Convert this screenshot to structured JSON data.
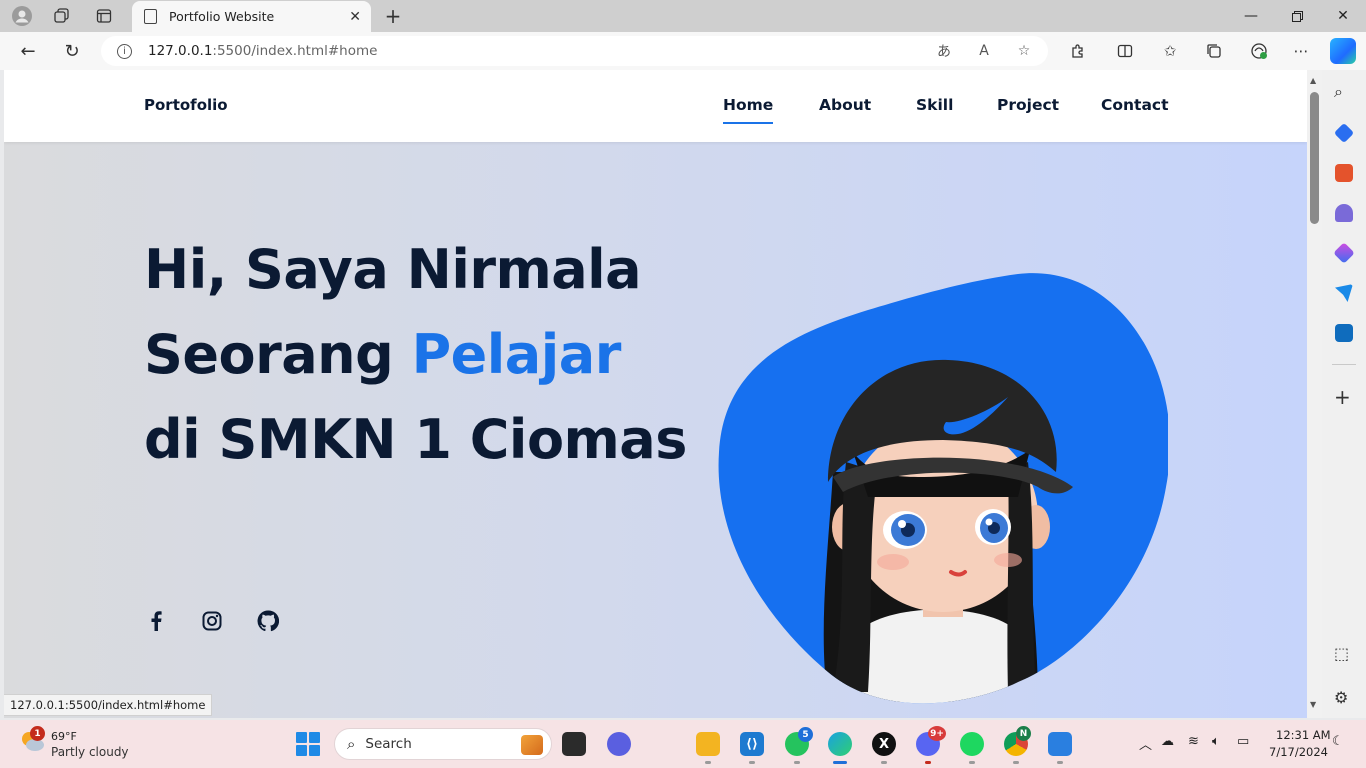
{
  "browser": {
    "tab_title": "Portfolio Website",
    "url_host": "127.0.0.1",
    "url_rest": ":5500/index.html#home",
    "status_url": "127.0.0.1:5500/index.html#home"
  },
  "site": {
    "logo": "Portofolio",
    "nav": [
      "Home",
      "About",
      "Skill",
      "Project",
      "Contact"
    ],
    "active_nav": "Home",
    "hero": {
      "line1": "Hi, Saya Nirmala",
      "line2_plain": "Seorang ",
      "line2_accent": "Pelajar",
      "line3": "di SMKN 1 Ciomas"
    },
    "social_icons": [
      "facebook-icon",
      "instagram-icon",
      "github-icon"
    ],
    "colors": {
      "accent": "#1a73e8",
      "text": "#0b1a33",
      "blob": "#1670f0"
    }
  },
  "taskbar": {
    "weather_temp": "69°F",
    "weather_desc": "Partly cloudy",
    "weather_badge": "1",
    "search_placeholder": "Search",
    "whatsapp_badge": "5",
    "discord_badge": "9+",
    "chrome_badge": "N",
    "time": "12:31 AM",
    "date": "7/17/2024"
  }
}
